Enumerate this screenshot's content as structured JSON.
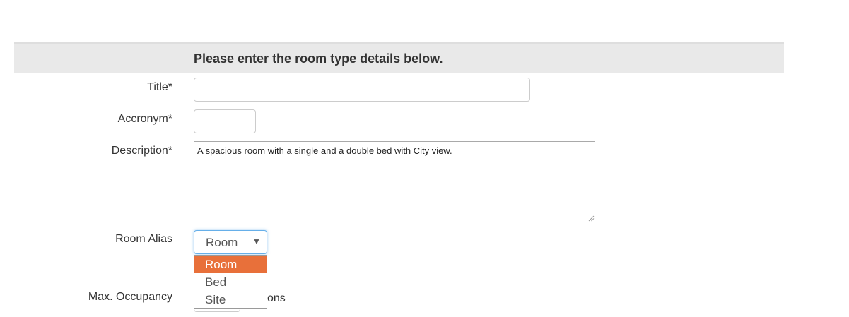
{
  "form": {
    "heading": "Please enter the room type details below.",
    "title": {
      "label": "Title*",
      "value": ""
    },
    "acronym": {
      "label": "Accronym*",
      "value": ""
    },
    "description": {
      "label": "Description*",
      "value": "A spacious room with a single and a double bed with City view."
    },
    "room_alias": {
      "label": "Room Alias",
      "selected": "Room",
      "options": [
        "Room",
        "Bed",
        "Site"
      ],
      "open": true
    },
    "max_occupancy": {
      "label": "Max. Occupancy",
      "suffix_visible": "ons"
    }
  },
  "colors": {
    "header_bg": "#e9e9e9",
    "option_highlight": "#e8703a",
    "focus_border": "#66afe9"
  },
  "icons": {
    "select_arrow": "triangle-down-icon"
  }
}
